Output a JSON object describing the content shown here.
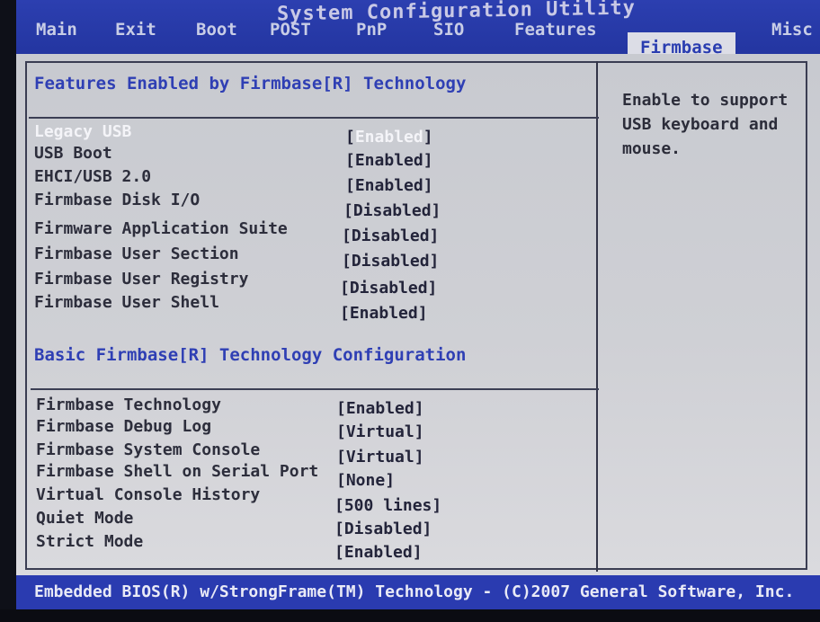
{
  "title": "System Configuration Utility",
  "tabs": [
    "Main",
    "Exit",
    "Boot",
    "POST",
    "PnP",
    "SIO",
    "Features",
    "Firmbase",
    "Misc"
  ],
  "active_tab": "Firmbase",
  "sections": [
    {
      "title": "Features Enabled by Firmbase[R] Technology",
      "items": [
        {
          "label": "Legacy USB",
          "value": "Enabled",
          "selected": true
        },
        {
          "label": "USB Boot",
          "value": "Enabled"
        },
        {
          "label": "EHCI/USB 2.0",
          "value": "Enabled"
        },
        {
          "label": "Firmbase Disk I/O",
          "value": "Disabled"
        },
        {
          "label": "Firmware Application Suite",
          "value": "Disabled"
        },
        {
          "label": "Firmbase User Section",
          "value": "Disabled"
        },
        {
          "label": "Firmbase User Registry",
          "value": "Disabled"
        },
        {
          "label": "Firmbase User Shell",
          "value": "Enabled"
        }
      ]
    },
    {
      "title": "Basic Firmbase[R] Technology Configuration",
      "items": [
        {
          "label": "Firmbase Technology",
          "value": "Enabled"
        },
        {
          "label": "Firmbase Debug Log",
          "value": "Virtual"
        },
        {
          "label": "Firmbase System Console",
          "value": "Virtual"
        },
        {
          "label": "Firmbase Shell on Serial Port",
          "value": "None"
        },
        {
          "label": "Virtual Console History",
          "value": "500 lines"
        },
        {
          "label": "Quiet Mode",
          "value": "Disabled"
        },
        {
          "label": "Strict Mode",
          "value": "Enabled"
        }
      ]
    }
  ],
  "help_text": "Enable to support USB keyboard and mouse.",
  "footer": "Embedded BIOS(R) w/StrongFrame(TM) Technology - (C)2007 General Software, Inc."
}
